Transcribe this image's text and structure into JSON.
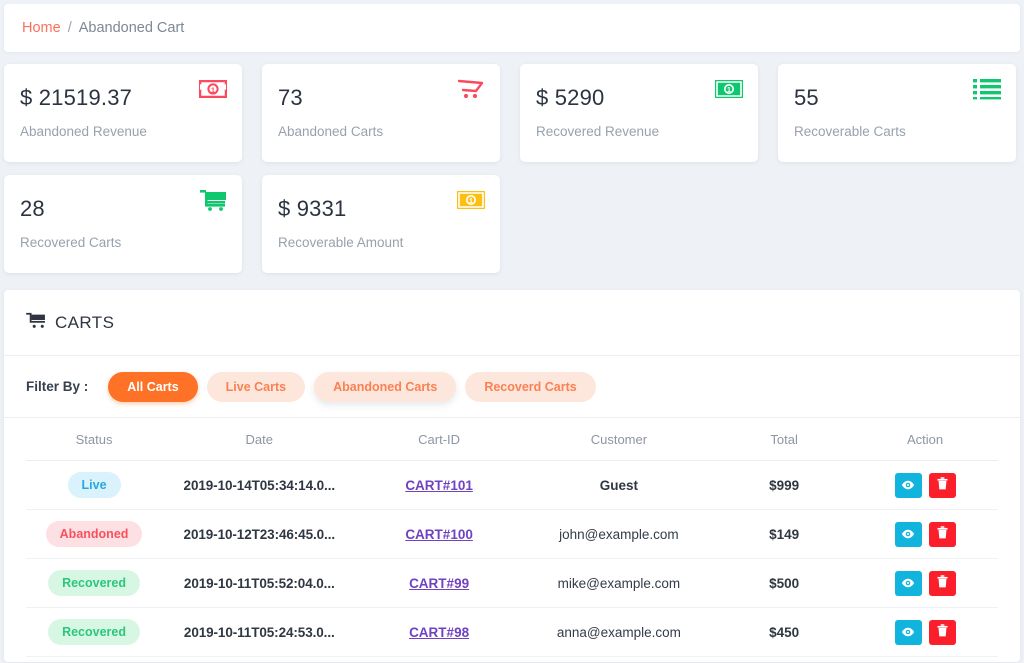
{
  "breadcrumb": {
    "home_label": "Home",
    "separator": "/",
    "current_label": "Abandoned Cart"
  },
  "stats": [
    {
      "value": "$ 21519.37",
      "label": "Abandoned Revenue",
      "icon": "money-bill-icon",
      "icon_color": "#fb4a5e"
    },
    {
      "value": "73",
      "label": "Abandoned Carts",
      "icon": "cart-outline-icon",
      "icon_color": "#fb4a5e"
    },
    {
      "value": "$ 5290",
      "label": "Recovered Revenue",
      "icon": "money-bill-icon",
      "icon_color": "#0fc76e"
    },
    {
      "value": "55",
      "label": "Recoverable Carts",
      "icon": "list-icon",
      "icon_color": "#0fc76e"
    },
    {
      "value": "28",
      "label": "Recovered Carts",
      "icon": "cart-filled-icon",
      "icon_color": "#0fc76e"
    },
    {
      "value": "$ 9331",
      "label": "Recoverable Amount",
      "icon": "money-bill-icon",
      "icon_color": "#fcbf16"
    }
  ],
  "panel": {
    "title": "CARTS",
    "title_icon": "cart-filled-icon"
  },
  "filter": {
    "label": "Filter By :",
    "buttons": [
      {
        "label": "All Carts",
        "active": true
      },
      {
        "label": "Live Carts",
        "active": false
      },
      {
        "label": "Abandoned Carts",
        "active": false
      },
      {
        "label": "Recoverd Carts",
        "active": false
      }
    ]
  },
  "table": {
    "columns": [
      "Status",
      "Date",
      "Cart-ID",
      "Customer",
      "Total",
      "Action"
    ],
    "rows": [
      {
        "status": "Live",
        "status_type": "live",
        "date": "2019-10-14T05:34:14.0...",
        "cart_id": "CART#101",
        "customer": "Guest",
        "customer_bold": true,
        "total": "$999",
        "actions": [
          "eye-icon",
          "trash-icon"
        ]
      },
      {
        "status": "Abandoned",
        "status_type": "abandoned",
        "date": "2019-10-12T23:46:45.0...",
        "cart_id": "CART#100",
        "customer": "john@example.com",
        "customer_bold": false,
        "total": "$149",
        "actions": [
          "eye-icon",
          "trash-icon"
        ]
      },
      {
        "status": "Recovered",
        "status_type": "recovered",
        "date": "2019-10-11T05:52:04.0...",
        "cart_id": "CART#99",
        "customer": "mike@example.com",
        "customer_bold": false,
        "total": "$500",
        "actions": [
          "eye-icon",
          "trash-icon"
        ]
      },
      {
        "status": "Recovered",
        "status_type": "recovered",
        "date": "2019-10-11T05:24:53.0...",
        "cart_id": "CART#98",
        "customer": "anna@example.com",
        "customer_bold": false,
        "total": "$450",
        "actions": [
          "eye-icon",
          "trash-icon"
        ]
      }
    ]
  },
  "colors": {
    "accent_orange": "#fd7226",
    "brand_red": "#fb4a5e",
    "green": "#0fc76e",
    "gold": "#fcbf16",
    "cyan": "#11b4dd",
    "danger": "#fb1e2b",
    "link_purple": "#6f42c1",
    "page_bg": "#eef1f5"
  }
}
